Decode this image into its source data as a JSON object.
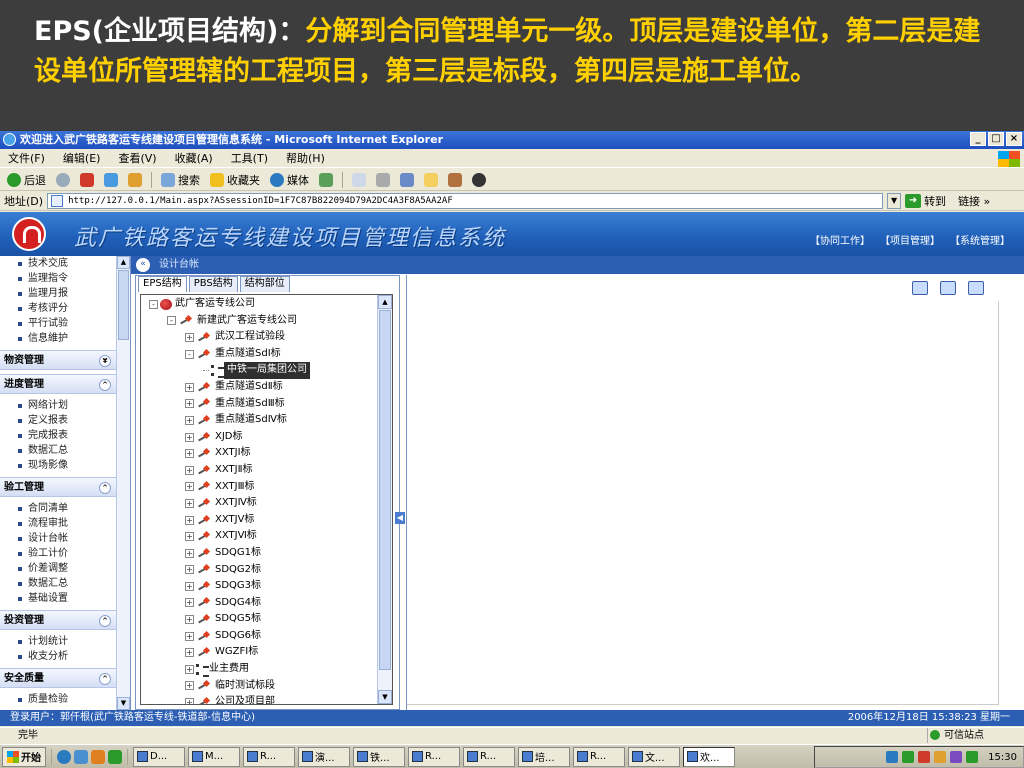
{
  "slide": {
    "heading_white": "EPS(企业项目结构)：",
    "heading_yellow": "分解到合同管理单元一级。顶层是建设单位，第二层是建设单位所管理辖的工程项目，第三层是标段，第四层是施工单位。"
  },
  "window": {
    "title": "欢迎进入武广铁路客运专线建设项目管理信息系统  - Microsoft Internet Explorer",
    "controls": [
      "_",
      "□",
      "×"
    ]
  },
  "menubar": [
    "文件(F)",
    "编辑(E)",
    "查看(V)",
    "收藏(A)",
    "工具(T)",
    "帮助(H)"
  ],
  "toolbar": {
    "back": "后退",
    "search": "搜索",
    "favorites": "收藏夹",
    "media": "媒体"
  },
  "address": {
    "label": "地址(D)",
    "url": "http://127.0.0.1/Main.aspx?ASsessionID=1F7C87B822094D79A2DC4A3F8A5AA2AF",
    "go": "转到",
    "links": "链接 »"
  },
  "app": {
    "title": "武广铁路客运专线建设项目管理信息系统",
    "top_links": [
      "【协同工作】",
      "【项目管理】",
      "【系统管理】"
    ]
  },
  "sidebar": {
    "top_items": [
      "技术交底",
      "监理指令",
      "监理月报",
      "考核评分",
      "平行试验",
      "信息維护"
    ],
    "groups": [
      {
        "label": "物资管理",
        "toggle": "¥",
        "items": []
      },
      {
        "label": "进度管理",
        "toggle": "^",
        "items": [
          "网络计划",
          "定义报表",
          "完成报表",
          "数据汇总",
          "现场影像"
        ]
      },
      {
        "label": "验工管理",
        "toggle": "^",
        "items": [
          "合同清单",
          "流程审批",
          "设计台帐",
          "验工计价",
          "价差调整",
          "数据汇总",
          "基础设置"
        ]
      },
      {
        "label": "投资管理",
        "toggle": "^",
        "items": [
          "计划统计",
          "收支分析"
        ]
      },
      {
        "label": "安全质量",
        "toggle": "^",
        "items": [
          "质量检验"
        ]
      }
    ]
  },
  "content": {
    "breadcrumb": "设计台帐",
    "tabs": [
      "EPS结构",
      "PBS结构",
      "结构部位"
    ],
    "tree": [
      {
        "level": 0,
        "pm": "-",
        "icon": "root",
        "label": "武广客运专线公司"
      },
      {
        "level": 1,
        "pm": "-",
        "icon": "ok",
        "label": "新建武广客运专线公司"
      },
      {
        "level": 2,
        "pm": "+",
        "icon": "ok",
        "label": "武汉工程试验段"
      },
      {
        "level": 2,
        "pm": "-",
        "icon": "ok",
        "label": "重点隧道SdⅠ标"
      },
      {
        "level": 3,
        "pm": "",
        "icon": "list",
        "label": "中铁一局集团公司",
        "selected": true
      },
      {
        "level": 2,
        "pm": "+",
        "icon": "ok",
        "label": "重点隧道SdⅡ标"
      },
      {
        "level": 2,
        "pm": "+",
        "icon": "ok",
        "label": "重点隧道SdⅢ标"
      },
      {
        "level": 2,
        "pm": "+",
        "icon": "ok",
        "label": "重点隧道SdⅣ标"
      },
      {
        "level": 2,
        "pm": "+",
        "icon": "ok",
        "label": "XJD标"
      },
      {
        "level": 2,
        "pm": "+",
        "icon": "ok",
        "label": "XXTJⅠ标"
      },
      {
        "level": 2,
        "pm": "+",
        "icon": "ok",
        "label": "XXTJⅡ标"
      },
      {
        "level": 2,
        "pm": "+",
        "icon": "ok",
        "label": "XXTJⅢ标"
      },
      {
        "level": 2,
        "pm": "+",
        "icon": "ok",
        "label": "XXTJⅣ标"
      },
      {
        "level": 2,
        "pm": "+",
        "icon": "ok",
        "label": "XXTJⅤ标"
      },
      {
        "level": 2,
        "pm": "+",
        "icon": "ok",
        "label": "XXTJⅥ标"
      },
      {
        "level": 2,
        "pm": "+",
        "icon": "ok",
        "label": "SDQG1标"
      },
      {
        "level": 2,
        "pm": "+",
        "icon": "ok",
        "label": "SDQG2标"
      },
      {
        "level": 2,
        "pm": "+",
        "icon": "ok",
        "label": "SDQG3标"
      },
      {
        "level": 2,
        "pm": "+",
        "icon": "ok",
        "label": "SDQG4标"
      },
      {
        "level": 2,
        "pm": "+",
        "icon": "ok",
        "label": "SDQG5标"
      },
      {
        "level": 2,
        "pm": "+",
        "icon": "ok",
        "label": "SDQG6标"
      },
      {
        "level": 2,
        "pm": "+",
        "icon": "ok",
        "label": "WGZFI标"
      },
      {
        "level": 2,
        "pm": "+",
        "icon": "list",
        "label": "业主费用"
      },
      {
        "level": 2,
        "pm": "+",
        "icon": "ok",
        "label": "临时测试标段"
      },
      {
        "level": 2,
        "pm": "+",
        "icon": "ok",
        "label": "公司及项目部"
      }
    ]
  },
  "status": {
    "user": "登录用户：郭仟根(武广铁路客运专线-铁道部-信息中心)",
    "datetime": "2006年12月18日 15:38:23 星期一"
  },
  "ie_status": {
    "left": "完毕",
    "zone": "可信站点"
  },
  "taskbar": {
    "start": "开始",
    "tasks": [
      "D...",
      "M...",
      "R...",
      "演...",
      "铁...",
      "R...",
      "R...",
      "培...",
      "R...",
      "文...",
      "欢..."
    ],
    "clock": "15:30"
  }
}
